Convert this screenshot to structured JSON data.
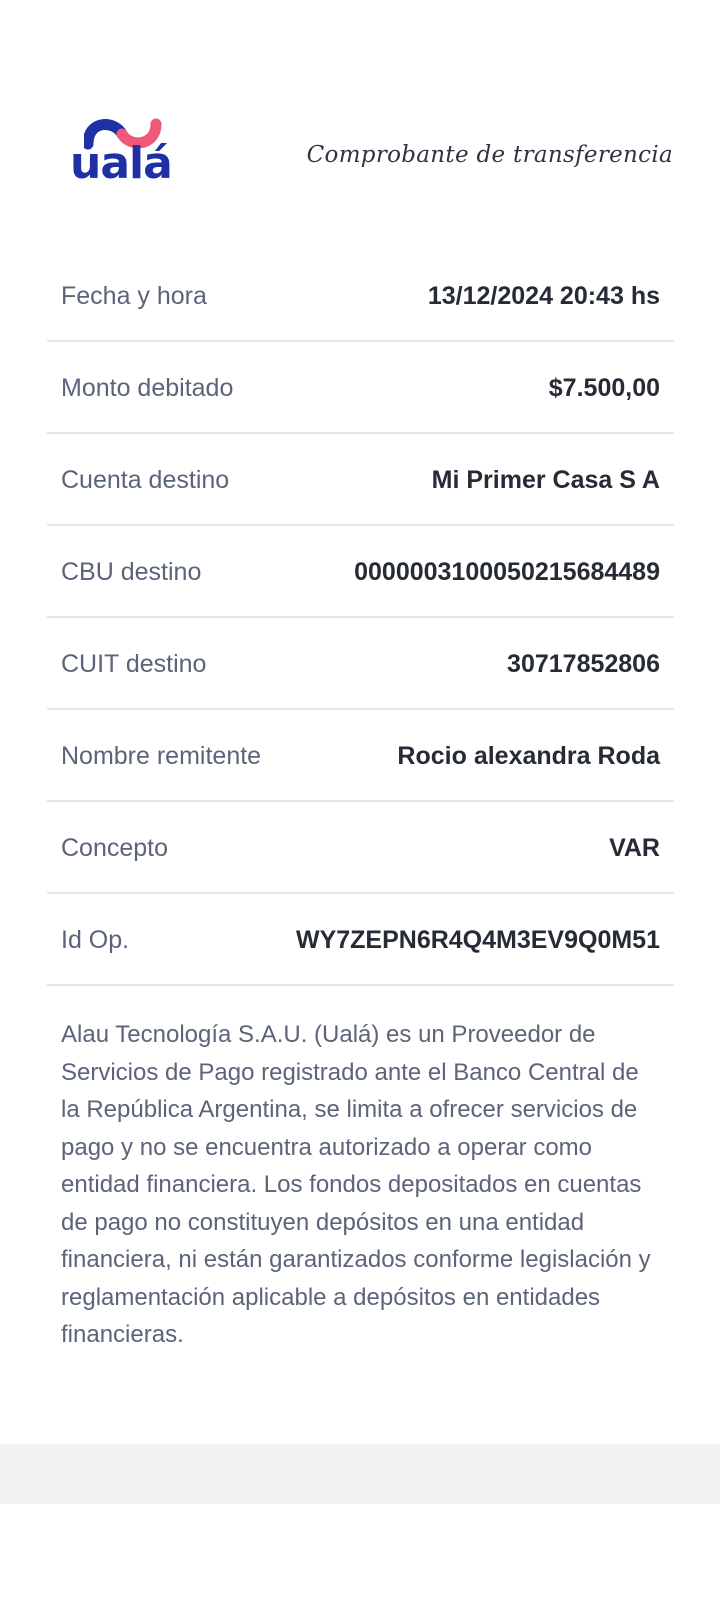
{
  "brand": {
    "logo_text": "ualá",
    "colors": {
      "logo_text": "#1f2fa5",
      "logo_wave_blue": "#1f2fa5",
      "logo_wave_pink": "#f0587a"
    }
  },
  "header": {
    "title": "Comprobante de transferencia"
  },
  "rows": [
    {
      "label": "Fecha y hora",
      "value": "13/12/2024 20:43 hs"
    },
    {
      "label": "Monto debitado",
      "value": "$7.500,00"
    },
    {
      "label": "Cuenta destino",
      "value": "Mi Primer Casa S A"
    },
    {
      "label": "CBU destino",
      "value": "0000003100050215684489"
    },
    {
      "label": "CUIT destino",
      "value": "30717852806"
    },
    {
      "label": "Nombre remitente",
      "value": "Rocio alexandra Roda"
    },
    {
      "label": "Concepto",
      "value": "VAR"
    },
    {
      "label": "Id Op.",
      "value": "WY7ZEPN6R4Q4M3EV9Q0M51"
    }
  ],
  "legal_text": "Alau Tecnología S.A.U. (Ualá) es un Proveedor de Servicios de Pago registrado ante el Banco Central de la República Argentina, se limita a ofrecer servicios de pago y no se encuentra autorizado a operar como entidad financiera. Los fondos depositados en cuentas de pago no constituyen depósitos en una entidad financiera, ni están garantizados conforme legislación y reglamentación aplicable a depósitos en entidades financieras."
}
